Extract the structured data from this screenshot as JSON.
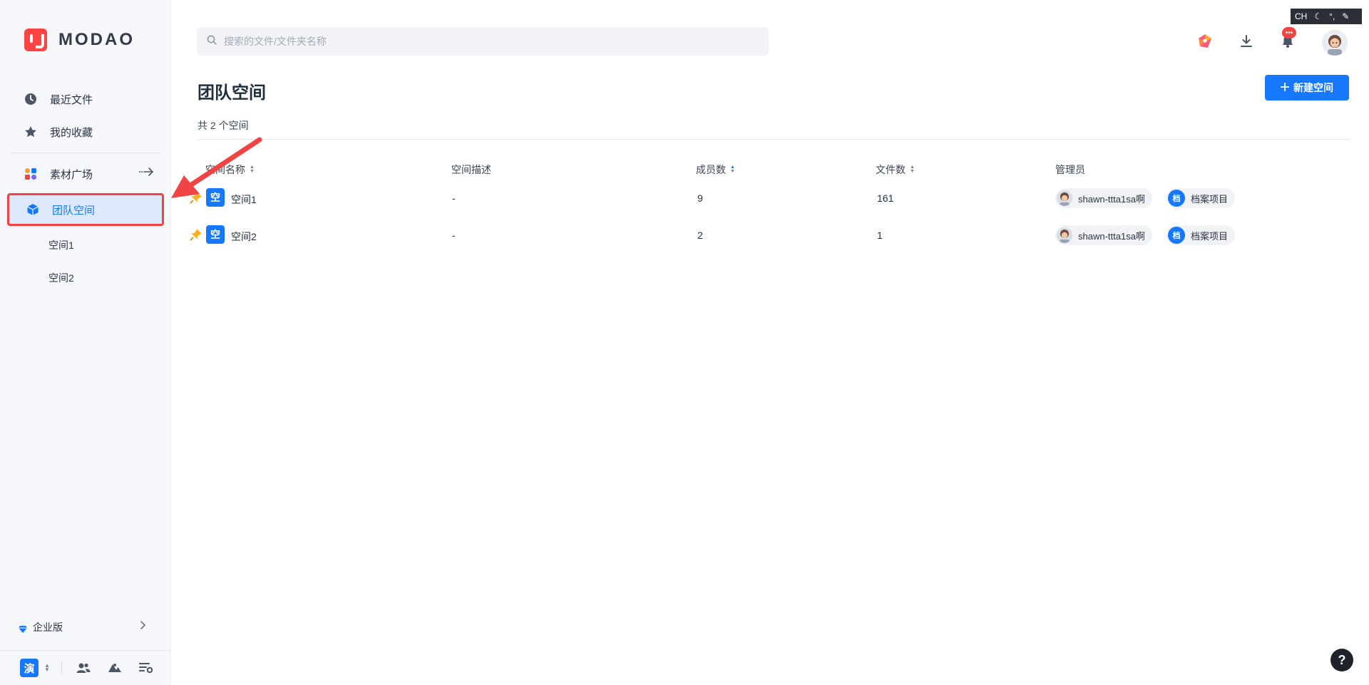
{
  "brand": {
    "name": "MODAO"
  },
  "ime": {
    "label": "CH"
  },
  "sidebar": {
    "items": [
      {
        "label": "最近文件",
        "icon": "clock-icon"
      },
      {
        "label": "我的收藏",
        "icon": "star-icon"
      },
      {
        "label": "素材广场",
        "icon": "apps-icon"
      },
      {
        "label": "团队空间",
        "icon": "cube-icon"
      }
    ],
    "sub_items": [
      "空间1",
      "空间2"
    ],
    "enterprise": "企业版",
    "workspace_badge": "演"
  },
  "header": {
    "search_placeholder": "搜索的文件/文件夹名称",
    "notif_badge": "•••"
  },
  "page": {
    "title": "团队空间",
    "new_button": "新建空间",
    "count_text": "共 2 个空间"
  },
  "table": {
    "columns": [
      "空间名称",
      "空间描述",
      "成员数",
      "文件数",
      "管理员"
    ],
    "rows": [
      {
        "badge": "空",
        "name": "空间1",
        "desc": "-",
        "members": "9",
        "files": "161",
        "admin": "shawn-ttta1sa啊",
        "project_badge": "档",
        "project": "档案项目"
      },
      {
        "badge": "空",
        "name": "空间2",
        "desc": "-",
        "members": "2",
        "files": "1",
        "admin": "shawn-ttta1sa啊",
        "project_badge": "档",
        "project": "档案项目"
      }
    ]
  },
  "help": "?",
  "colors": {
    "accent": "#1677ff",
    "annotation": "#f04444",
    "sidebar_bg": "#f5f7fb"
  }
}
